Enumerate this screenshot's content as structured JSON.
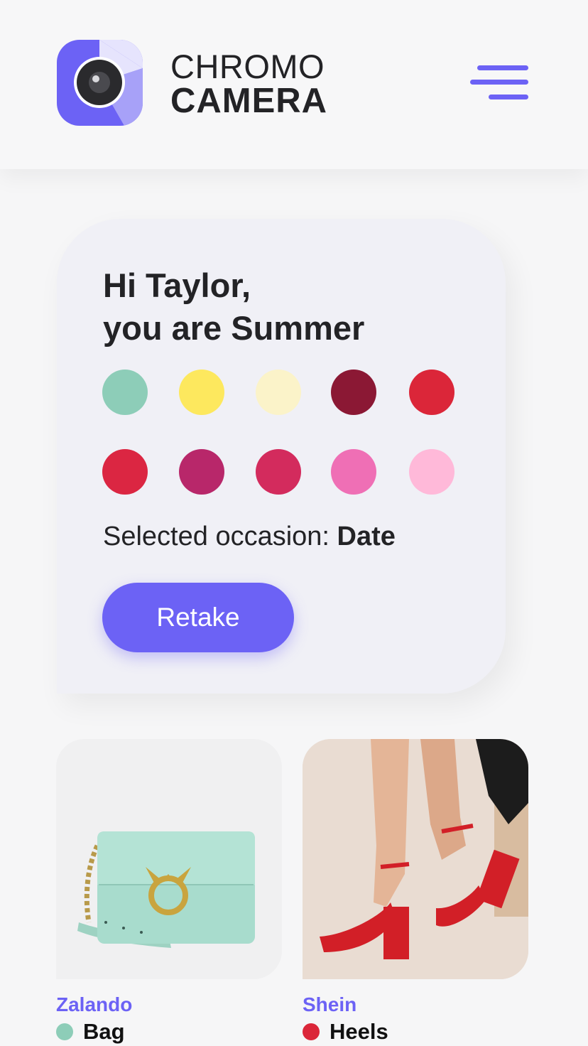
{
  "header": {
    "logo_line1": "CHROMO",
    "logo_line2": "CAMERA",
    "accent_color": "#6c62f5"
  },
  "result_card": {
    "greeting_line1": "Hi Taylor,",
    "greeting_line2": "you are Summer",
    "palette": [
      [
        "#8dcdb8",
        "#fde85e",
        "#fbf3c9",
        "#8b1834",
        "#db2639"
      ],
      [
        "#db2642",
        "#b8276a",
        "#d32b5d",
        "#ef6fb5",
        "#ffb9d9"
      ]
    ],
    "occasion_label": "Selected occasion: ",
    "occasion_value": "Date",
    "retake_label": "Retake"
  },
  "products": [
    {
      "brand": "Zalando",
      "item": "Bag",
      "color": "#8dcdb8",
      "icon": "mint-handbag-image"
    },
    {
      "brand": "Shein",
      "item": "Heels",
      "color": "#db2639",
      "icon": "red-heels-image"
    }
  ]
}
